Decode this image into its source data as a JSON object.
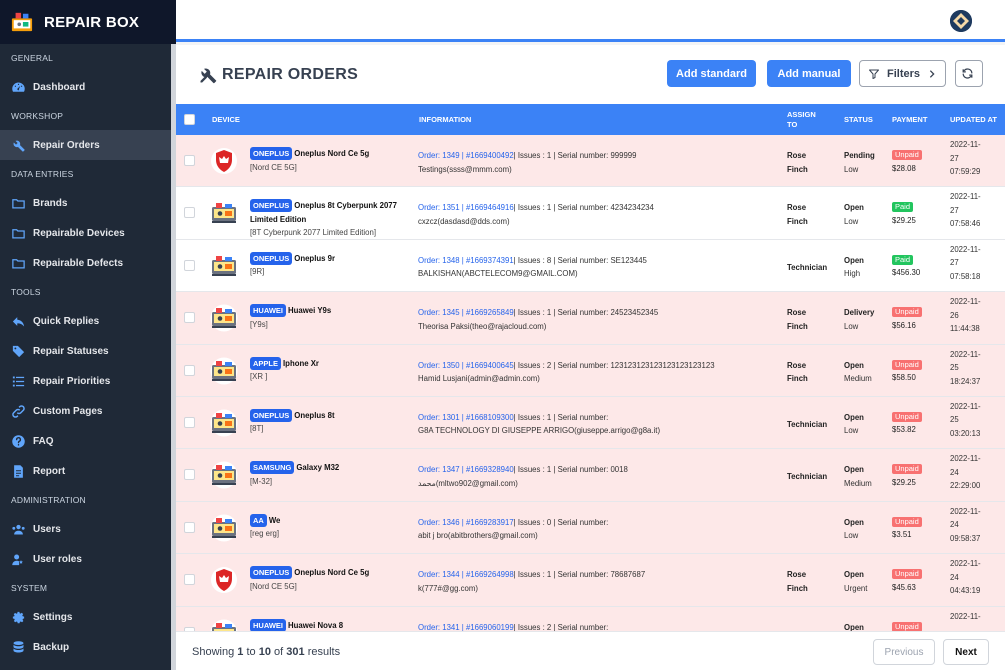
{
  "app": {
    "name": "REPAIR BOX"
  },
  "sidebar": {
    "sections": [
      {
        "title": "GENERAL",
        "items": [
          {
            "label": "Dashboard",
            "icon": "dashboard-icon"
          }
        ]
      },
      {
        "title": "WORKSHOP",
        "items": [
          {
            "label": "Repair Orders",
            "icon": "tools-icon",
            "active": true
          }
        ]
      },
      {
        "title": "DATA ENTRIES",
        "items": [
          {
            "label": "Brands",
            "icon": "folder-icon"
          },
          {
            "label": "Repairable Devices",
            "icon": "folder-icon"
          },
          {
            "label": "Repairable Defects",
            "icon": "folder-icon"
          }
        ]
      },
      {
        "title": "TOOLS",
        "items": [
          {
            "label": "Quick Replies",
            "icon": "reply-icon"
          },
          {
            "label": "Repair Statuses",
            "icon": "tags-icon"
          },
          {
            "label": "Repair Priorities",
            "icon": "list-icon"
          },
          {
            "label": "Custom Pages",
            "icon": "link-icon"
          },
          {
            "label": "FAQ",
            "icon": "question-icon"
          },
          {
            "label": "Report",
            "icon": "report-icon"
          }
        ]
      },
      {
        "title": "ADMINISTRATION",
        "items": [
          {
            "label": "Users",
            "icon": "users-icon"
          },
          {
            "label": "User roles",
            "icon": "user-role-icon"
          }
        ]
      },
      {
        "title": "SYSTEM",
        "items": [
          {
            "label": "Settings",
            "icon": "gear-icon"
          },
          {
            "label": "Backup",
            "icon": "database-icon"
          }
        ]
      }
    ]
  },
  "page": {
    "title": "REPAIR ORDERS",
    "buttons": {
      "add_standard": "Add standard",
      "add_manual": "Add manual",
      "filters": "Filters"
    }
  },
  "table": {
    "headers": {
      "device": "DEVICE",
      "information": "INFORMATION",
      "assign_to": "ASSIGN TO",
      "status": "STATUS",
      "payment": "PAYMENT",
      "updated_at": "UPDATED AT"
    },
    "rows": [
      {
        "brand": "ONEPLUS",
        "device": "Oneplus Nord Ce 5g",
        "model": "[Nord CE 5G]",
        "icon": "msi-shield-icon",
        "order": "Order: 1349 | #1669400492",
        "details": "| Issues : 1 | Serial number: 999999",
        "customer": "Testings(ssss@mmm.com)",
        "assign_line1": "Rose",
        "assign_line2": "Finch",
        "status": "Pending",
        "priority": "Low",
        "payment": "Unpaid",
        "amount": "$28.08",
        "date": "2022-11-",
        "day": "27",
        "time": "07:59:29"
      },
      {
        "brand": "ONEPLUS",
        "device": "Oneplus 8t Cyberpunk 2077 Limited Edition",
        "model": "[8T Cyberpunk 2077 Limited Edition]",
        "icon": "repair-shop-icon",
        "order": "Order: 1351 | #1669464916",
        "details": "| Issues : 1 | Serial number: 4234234234",
        "customer": "cxzcz(dasdasd@dds.com)",
        "assign_line1": "Rose",
        "assign_line2": "Finch",
        "status": "Open",
        "priority": "Low",
        "payment": "Paid",
        "amount": "$29.25",
        "date": "2022-11-",
        "day": "27",
        "time": "07:58:46"
      },
      {
        "brand": "ONEPLUS",
        "device": "Oneplus 9r",
        "model": "[9R]",
        "icon": "repair-shop-icon",
        "order": "Order: 1348 | #1669374391",
        "details": "| Issues : 8 | Serial number: SE123445",
        "customer": "BALKISHAN(ABCTELECOM9@GMAIL.COM)",
        "assign_line1": "Technician",
        "assign_line2": "",
        "status": "Open",
        "priority": "High",
        "payment": "Paid",
        "amount": "$456.30",
        "date": "2022-11-",
        "day": "27",
        "time": "07:58:18"
      },
      {
        "brand": "HUAWEI",
        "device": "Huawei Y9s",
        "model": "[Y9s]",
        "icon": "repair-shop-icon",
        "order": "Order: 1345 | #1669265849",
        "details": "| Issues : 1 | Serial number: 24523452345",
        "customer": "Theorisa Paksi(theo@rajacloud.com)",
        "assign_line1": "Rose",
        "assign_line2": "Finch",
        "status": "Delivery",
        "priority": "Low",
        "payment": "Unpaid",
        "amount": "$56.16",
        "date": "2022-11-",
        "day": "26",
        "time": "11:44:38"
      },
      {
        "brand": "APPLE",
        "device": "Iphone Xr",
        "model": "[XR ]",
        "icon": "repair-shop-icon",
        "order": "Order: 1350 | #1669400645",
        "details": "| Issues : 2 | Serial number: 123123123123123123123123",
        "customer": "Hamid Lusjani(admin@admin.com)",
        "assign_line1": "Rose",
        "assign_line2": "Finch",
        "status": "Open",
        "priority": "Medium",
        "payment": "Unpaid",
        "amount": "$58.50",
        "date": "2022-11-",
        "day": "25",
        "time": "18:24:37"
      },
      {
        "brand": "ONEPLUS",
        "device": "Oneplus 8t",
        "model": "[8T]",
        "icon": "repair-shop-icon",
        "order": "Order: 1301 | #1668109300",
        "details": "| Issues : 1 | Serial number:",
        "customer": "G8A TECHNOLOGY DI GIUSEPPE ARRIGO(giuseppe.arrigo@g8a.it)",
        "assign_line1": "Technician",
        "assign_line2": "",
        "status": "Open",
        "priority": "Low",
        "payment": "Unpaid",
        "amount": "$53.82",
        "date": "2022-11-",
        "day": "25",
        "time": "03:20:13"
      },
      {
        "brand": "SAMSUNG",
        "device": "Galaxy M32",
        "model": "[M-32]",
        "icon": "repair-shop-icon",
        "order": "Order: 1347 | #1669328940",
        "details": "| Issues : 1 | Serial number: 0018",
        "customer": "محمد(mltwo902@gmail.com)",
        "assign_line1": "Technician",
        "assign_line2": "",
        "status": "Open",
        "priority": "Medium",
        "payment": "Unpaid",
        "amount": "$29.25",
        "date": "2022-11-",
        "day": "24",
        "time": "22:29:00"
      },
      {
        "brand": "AA",
        "device": "We",
        "model": "[reg erg]",
        "icon": "repair-shop-icon",
        "order": "Order: 1346 | #1669283917",
        "details": "| Issues : 0 | Serial number:",
        "customer": "abit j bro(abitbrothers@gmail.com)",
        "assign_line1": "",
        "assign_line2": "",
        "status": "Open",
        "priority": "Low",
        "payment": "Unpaid",
        "amount": "$3.51",
        "date": "2022-11-",
        "day": "24",
        "time": "09:58:37"
      },
      {
        "brand": "ONEPLUS",
        "device": "Oneplus Nord Ce 5g",
        "model": "[Nord CE 5G]",
        "icon": "msi-shield-icon",
        "order": "Order: 1344 | #1669264998",
        "details": "| Issues : 1 | Serial number: 78687687",
        "customer": "k(777#@gg.com)",
        "assign_line1": "Rose",
        "assign_line2": "Finch",
        "status": "Open",
        "priority": "Urgent",
        "payment": "Unpaid",
        "amount": "$45.63",
        "date": "2022-11-",
        "day": "24",
        "time": "04:43:19"
      },
      {
        "brand": "HUAWEI",
        "device": "Huawei Nova 8",
        "model": "",
        "icon": "repair-shop-icon",
        "order": "Order: 1341 | #1669060199",
        "details": "| Issues : 2 | Serial number:",
        "customer": "",
        "assign_line1": "",
        "assign_line2": "",
        "status": "Open",
        "priority": "",
        "payment": "Unpaid",
        "amount": "",
        "date": "2022-11-",
        "day": "",
        "time": ""
      }
    ]
  },
  "footer": {
    "showing": "Showing",
    "from": "1",
    "to_word": "to",
    "to": "10",
    "of_word": "of",
    "total": "301",
    "results_word": "results",
    "prev": "Previous",
    "next": "Next"
  },
  "colors": {
    "primary": "#3b82f6",
    "sidebar": "#1f2937",
    "unpaid": "#f87171",
    "paid": "#22c55e",
    "row_unpaid": "#fde8e8"
  }
}
